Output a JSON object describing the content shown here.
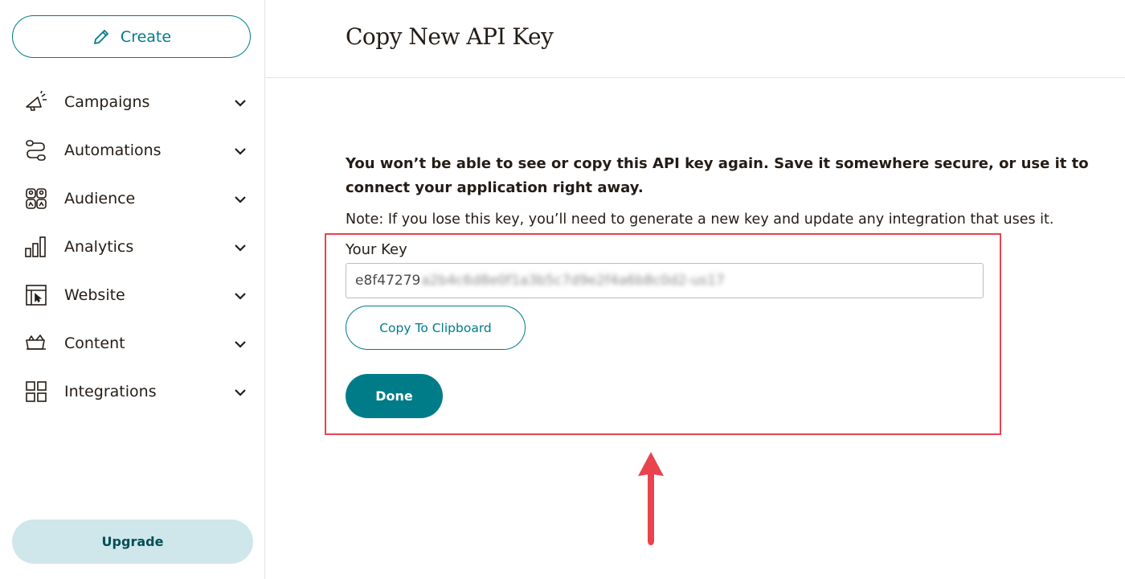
{
  "sidebar": {
    "create_label": "Create",
    "items": [
      {
        "label": "Campaigns",
        "icon": "megaphone-icon"
      },
      {
        "label": "Automations",
        "icon": "automation-flow-icon"
      },
      {
        "label": "Audience",
        "icon": "audience-icon"
      },
      {
        "label": "Analytics",
        "icon": "bar-chart-icon"
      },
      {
        "label": "Website",
        "icon": "website-icon"
      },
      {
        "label": "Content",
        "icon": "content-icon"
      },
      {
        "label": "Integrations",
        "icon": "grid-icon"
      }
    ],
    "upgrade_label": "Upgrade"
  },
  "main": {
    "title": "Copy New API Key",
    "warning": "You won’t be able to see or copy this API key again. Save it somewhere secure, or use it to connect your application right away.",
    "note": "Note: If you lose this key, you’ll need to generate a new key and update any integration that uses it.",
    "key_label": "Your Key",
    "key_visible": "e8f47279",
    "key_obscured": "a2b4c6d8e0f1a3b5c7d9e2f4a6b8c0d2-us17",
    "copy_label": "Copy To Clipboard",
    "done_label": "Done"
  },
  "colors": {
    "accent": "#007c89",
    "highlight": "#e8434f",
    "upgrade_bg": "#cfe6ea"
  }
}
